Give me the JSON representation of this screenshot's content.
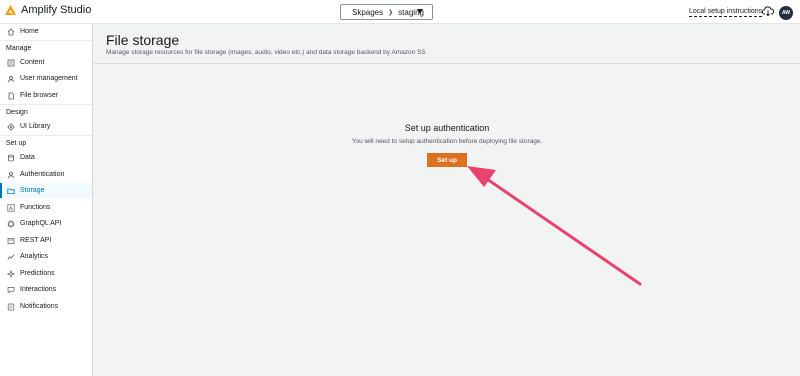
{
  "app": {
    "title": "Amplify Studio"
  },
  "topbar": {
    "app_name": "Skpages",
    "env_name": "staging",
    "local_setup": "Local setup instructions",
    "avatar_initials": "AW"
  },
  "sidebar": {
    "home": "Home",
    "sections": {
      "manage": "Manage",
      "design": "Design",
      "setup": "Set up"
    },
    "manage_items": [
      "Content",
      "User management",
      "File browser"
    ],
    "design_items": [
      "UI Library"
    ],
    "setup_items": [
      "Data",
      "Authentication",
      "Storage",
      "Functions",
      "GraphQL API",
      "REST API",
      "Analytics",
      "Predictions",
      "Interactions",
      "Notifications"
    ],
    "active_item": "Storage"
  },
  "header": {
    "title": "File storage",
    "description": "Manage storage resources for file storage (images, audio, video etc.) and data storage backend by Amazon S3."
  },
  "empty_state": {
    "title": "Set up authentication",
    "description": "You will need to setup authentication before deploying file storage.",
    "button_label": "Set up"
  },
  "colors": {
    "accent": "#0073bb",
    "button": "#dd7121",
    "annotation_arrow": "#e8436f"
  }
}
